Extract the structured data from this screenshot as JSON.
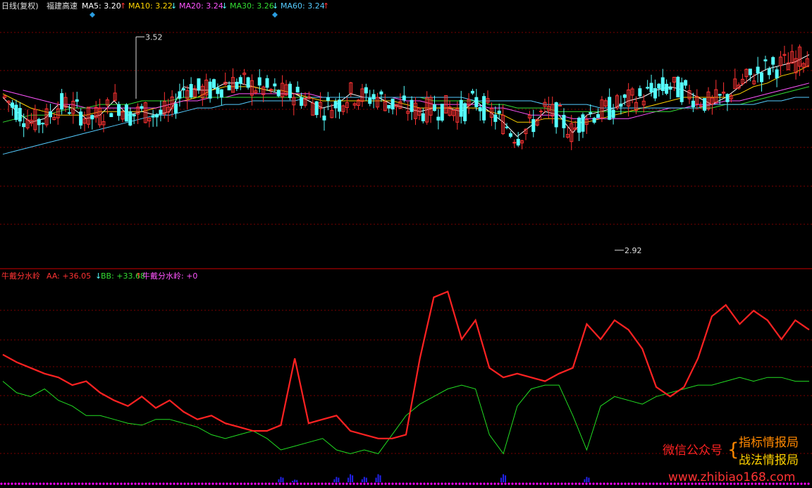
{
  "title": {
    "period": "日线(复权)",
    "stock_name": "福建高速",
    "ma_labels": [
      {
        "label": "MA5: 3.20",
        "arrow": "↑",
        "color": "#ffffff"
      },
      {
        "label": "MA10: 3.22",
        "arrow": "↓",
        "color": "#ffd400"
      },
      {
        "label": "MA20: 3.24",
        "arrow": "↓",
        "color": "#ff55ff"
      },
      {
        "label": "MA30: 3.26",
        "arrow": "↓",
        "color": "#33dd33"
      },
      {
        "label": "MA60: 3.24",
        "arrow": "↑",
        "color": "#55ccff"
      }
    ]
  },
  "indicator": {
    "name": "牛戴分水岭",
    "aa_label": "AA: +36.05",
    "aa_arrow": "↓",
    "bb_label": "BB: +33.68",
    "bb_arrow": "↑",
    "zero_label": "牛戴分水岭: +0"
  },
  "watermark": {
    "left": "微信公众号",
    "right_top": "指标情报局",
    "right_bottom": "战法情报局",
    "url": "www.zhibiao168.com"
  },
  "colors": {
    "up": "#ff3333",
    "down": "#55ffff",
    "aa": "#ff2222",
    "bb": "#22dd22",
    "volume": "#2222ee",
    "grid": "#7a0000",
    "separator": "#cc0000",
    "diamond": "#2a9de0"
  },
  "chart_data": [
    {
      "type": "candlestick",
      "title": "",
      "y_range": [
        2.88,
        3.58
      ],
      "annotations": [
        {
          "text": "3.52",
          "value": 3.52,
          "kind": "high"
        },
        {
          "text": "2.92",
          "value": 2.92,
          "kind": "low"
        }
      ],
      "series": [
        {
          "name": "MA5",
          "values": [
            3.35,
            3.31,
            3.28,
            3.29,
            3.33,
            3.32,
            3.29,
            3.3,
            3.34,
            3.3,
            3.31,
            3.3,
            3.31,
            3.38,
            3.37,
            3.37,
            3.39,
            3.39,
            3.38,
            3.37,
            3.36,
            3.36,
            3.34,
            3.32,
            3.33,
            3.36,
            3.35,
            3.35,
            3.33,
            3.32,
            3.31,
            3.32,
            3.32,
            3.31,
            3.34,
            3.31,
            3.28,
            3.24,
            3.27,
            3.31,
            3.3,
            3.25,
            3.3,
            3.31,
            3.32,
            3.34,
            3.35,
            3.37,
            3.38,
            3.37,
            3.35,
            3.33,
            3.35,
            3.38,
            3.41,
            3.43,
            3.44,
            3.45,
            3.47
          ]
        },
        {
          "name": "MA10",
          "values": [
            3.36,
            3.34,
            3.32,
            3.31,
            3.3,
            3.3,
            3.3,
            3.31,
            3.31,
            3.31,
            3.31,
            3.32,
            3.33,
            3.34,
            3.35,
            3.37,
            3.38,
            3.38,
            3.38,
            3.37,
            3.37,
            3.36,
            3.35,
            3.34,
            3.34,
            3.34,
            3.34,
            3.34,
            3.34,
            3.33,
            3.32,
            3.32,
            3.32,
            3.32,
            3.32,
            3.31,
            3.3,
            3.28,
            3.28,
            3.29,
            3.29,
            3.28,
            3.28,
            3.29,
            3.3,
            3.31,
            3.32,
            3.33,
            3.34,
            3.35,
            3.35,
            3.35,
            3.35,
            3.36,
            3.38,
            3.39,
            3.41,
            3.42,
            3.44
          ]
        },
        {
          "name": "MA20",
          "values": [
            3.37,
            3.36,
            3.35,
            3.34,
            3.33,
            3.33,
            3.32,
            3.32,
            3.32,
            3.32,
            3.32,
            3.32,
            3.33,
            3.34,
            3.34,
            3.35,
            3.35,
            3.36,
            3.36,
            3.36,
            3.36,
            3.36,
            3.36,
            3.35,
            3.35,
            3.35,
            3.35,
            3.35,
            3.35,
            3.34,
            3.34,
            3.33,
            3.33,
            3.33,
            3.33,
            3.32,
            3.32,
            3.31,
            3.3,
            3.3,
            3.3,
            3.29,
            3.29,
            3.29,
            3.29,
            3.29,
            3.3,
            3.31,
            3.32,
            3.32,
            3.33,
            3.33,
            3.34,
            3.34,
            3.35,
            3.36,
            3.37,
            3.38,
            3.39
          ]
        },
        {
          "name": "MA30",
          "values": [
            3.28,
            3.29,
            3.3,
            3.3,
            3.31,
            3.32,
            3.32,
            3.33,
            3.33,
            3.33,
            3.34,
            3.34,
            3.34,
            3.35,
            3.35,
            3.35,
            3.35,
            3.35,
            3.35,
            3.35,
            3.35,
            3.35,
            3.35,
            3.35,
            3.35,
            3.35,
            3.35,
            3.35,
            3.35,
            3.35,
            3.35,
            3.34,
            3.34,
            3.34,
            3.34,
            3.33,
            3.33,
            3.32,
            3.32,
            3.32,
            3.31,
            3.31,
            3.31,
            3.31,
            3.31,
            3.31,
            3.31,
            3.31,
            3.31,
            3.32,
            3.32,
            3.32,
            3.33,
            3.33,
            3.34,
            3.35,
            3.36,
            3.37,
            3.38
          ]
        },
        {
          "name": "MA60",
          "values": [
            3.19,
            3.2,
            3.21,
            3.22,
            3.23,
            3.24,
            3.25,
            3.26,
            3.27,
            3.28,
            3.29,
            3.3,
            3.3,
            3.31,
            3.32,
            3.32,
            3.33,
            3.33,
            3.34,
            3.34,
            3.34,
            3.34,
            3.35,
            3.35,
            3.35,
            3.35,
            3.35,
            3.35,
            3.35,
            3.35,
            3.35,
            3.35,
            3.35,
            3.35,
            3.34,
            3.34,
            3.34,
            3.34,
            3.34,
            3.33,
            3.33,
            3.33,
            3.33,
            3.32,
            3.32,
            3.32,
            3.32,
            3.32,
            3.32,
            3.32,
            3.32,
            3.33,
            3.33,
            3.33,
            3.33,
            3.34,
            3.34,
            3.35,
            3.35
          ]
        }
      ]
    },
    {
      "type": "line",
      "title": "",
      "y_range": [
        -5,
        100
      ],
      "series": [
        {
          "name": "AA",
          "values": [
            62,
            58,
            55,
            52,
            50,
            46,
            48,
            42,
            38,
            35,
            40,
            34,
            38,
            32,
            28,
            30,
            26,
            24,
            22,
            22,
            25,
            60,
            26,
            28,
            30,
            22,
            20,
            18,
            18,
            20,
            60,
            92,
            95,
            70,
            80,
            55,
            50,
            52,
            50,
            48,
            52,
            55,
            78,
            70,
            80,
            75,
            65,
            45,
            40,
            45,
            60,
            82,
            88,
            78,
            85,
            80,
            70,
            80,
            75
          ]
        },
        {
          "name": "BB",
          "values": [
            48,
            42,
            40,
            44,
            38,
            35,
            30,
            30,
            28,
            26,
            25,
            28,
            28,
            26,
            24,
            20,
            18,
            20,
            22,
            18,
            12,
            14,
            16,
            18,
            12,
            10,
            12,
            10,
            20,
            30,
            36,
            40,
            44,
            46,
            44,
            20,
            10,
            35,
            44,
            46,
            46,
            30,
            12,
            35,
            40,
            38,
            36,
            40,
            42,
            44,
            46,
            46,
            48,
            50,
            48,
            50,
            50,
            48,
            48
          ]
        }
      ]
    }
  ]
}
